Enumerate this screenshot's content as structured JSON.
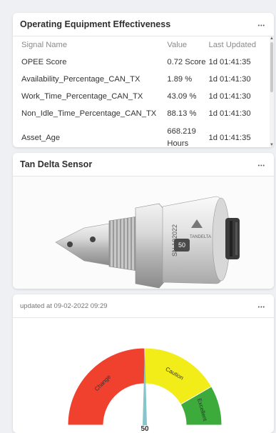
{
  "card1": {
    "title": "Operating Equipment Effectiveness",
    "columns": [
      "Signal Name",
      "Value",
      "Last Updated"
    ],
    "rows": [
      {
        "name": "OPEE Score",
        "value": "0.72 Score",
        "updated": "1d 01:41:35"
      },
      {
        "name": "Availability_Percentage_CAN_TX",
        "value": "1.89 %",
        "updated": "1d 01:41:30"
      },
      {
        "name": "Work_Time_Percentage_CAN_TX",
        "value": "43.09 %",
        "updated": "1d 01:41:30"
      },
      {
        "name": "Non_Idle_Time_Percentage_CAN_TX",
        "value": "88.13 %",
        "updated": "1d 01:41:30"
      },
      {
        "name": "Asset_Age",
        "value_line1": "668.219",
        "value_line2": "Hours",
        "updated": "1d 01:41:35"
      }
    ]
  },
  "card2": {
    "title": "Tan Delta Sensor",
    "tooltip_value": "50",
    "sensor_text_sn": "SN 102022",
    "sensor_brand": "TANDELTA"
  },
  "card3": {
    "updated": "updated at 09-02-2022 09:29",
    "gauge": {
      "value": "50",
      "value_num": 50,
      "segments": [
        {
          "label": "Change",
          "color": "#f0412e"
        },
        {
          "label": "Caution",
          "color": "#f2ec18"
        },
        {
          "label": "Excellent",
          "color": "#3cab3c"
        }
      ],
      "needle_color": "#86c5c9"
    }
  }
}
